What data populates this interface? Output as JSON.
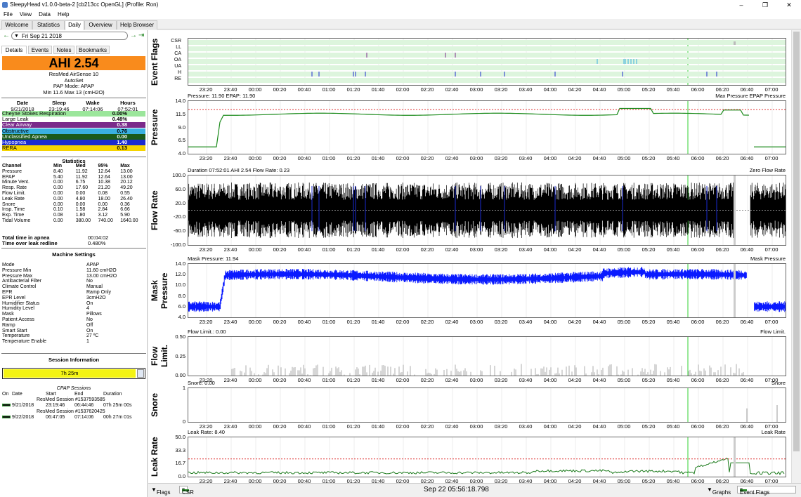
{
  "window": {
    "title": "SleepyHead v1.0.0-beta-2 [cb213cc OpenGL] (Profile: Ron)"
  },
  "menu": [
    "File",
    "View",
    "Data",
    "Help"
  ],
  "tabs": [
    "Welcome",
    "Statistics",
    "Daily",
    "Overview",
    "Help Browser"
  ],
  "date": {
    "value": "Fri Sep 21 2018"
  },
  "detail_tabs": [
    "Details",
    "Events",
    "Notes",
    "Bookmarks"
  ],
  "ahi": {
    "label": "AHI 2.54"
  },
  "machine": {
    "name": "ResMed AirSense 10",
    "model": "AutoSet",
    "mode": "PAP Mode: APAP",
    "range": "Min 11.6 Max 13 (cmH2O)"
  },
  "summary": {
    "headers": [
      "Date",
      "Sleep",
      "Wake",
      "Hours"
    ],
    "values": [
      "9/21/2018",
      "23:19:46",
      "07:14:06",
      "07:52:01"
    ]
  },
  "events": [
    {
      "name": "Cheyne Stokes Respiration",
      "value": "0.00%",
      "color": "#9be69b",
      "text": "#000"
    },
    {
      "name": "Large Leak",
      "value": "0.48%",
      "color": "#ffffff",
      "text": "#000"
    },
    {
      "name": "Clear Airway",
      "value": "0.38",
      "color": "#7a2a8a",
      "text": "#fff"
    },
    {
      "name": "Obstructive",
      "value": "0.76",
      "color": "#3ab0e0",
      "text": "#000"
    },
    {
      "name": "Unclassified Apnea",
      "value": "0.00",
      "color": "#1a5a1a",
      "text": "#fff"
    },
    {
      "name": "Hypopnea",
      "value": "1.40",
      "color": "#1a2ad0",
      "text": "#fff"
    },
    {
      "name": "RERA",
      "value": "0.13",
      "color": "#f5d400",
      "text": "#000"
    }
  ],
  "stats": {
    "title": "Statistics",
    "headers": [
      "Channel",
      "Min",
      "Med",
      "95%",
      "Max"
    ],
    "rows": [
      [
        "Pressure",
        "8.40",
        "11.92",
        "12.64",
        "13.00"
      ],
      [
        "EPAP",
        "5.40",
        "11.92",
        "12.64",
        "13.00"
      ],
      [
        "Minute Vent.",
        "0.00",
        "6.75",
        "10.38",
        "20.12"
      ],
      [
        "Resp. Rate",
        "0.00",
        "17.60",
        "21.20",
        "49.20"
      ],
      [
        "Flow Limit.",
        "0.00",
        "0.00",
        "0.08",
        "0.55"
      ],
      [
        "Leak Rate",
        "0.00",
        "4.80",
        "18.00",
        "26.40"
      ],
      [
        "Snore",
        "0.00",
        "0.00",
        "0.00",
        "0.36"
      ],
      [
        "Insp. Time",
        "0.10",
        "1.58",
        "2.84",
        "6.66"
      ],
      [
        "Exp. Time",
        "0.08",
        "1.80",
        "3.12",
        "5.90"
      ],
      [
        "Tidal Volume",
        "0.00",
        "380.00",
        "740.00",
        "1640.00"
      ]
    ],
    "apnea_time_label": "Total time in apnea",
    "apnea_time": "00:04:02",
    "leak_label": "Time over leak redline",
    "leak_value": "0.480%"
  },
  "settings": {
    "title": "Machine Settings",
    "rows": [
      [
        "Mode",
        "APAP"
      ],
      [
        "Pressure Min",
        "11.60 cmH2O"
      ],
      [
        "Pressure Max",
        "13.00 cmH2O"
      ],
      [
        "Antibacterial Filter",
        "No"
      ],
      [
        "Climate Control",
        "Manual"
      ],
      [
        "EPR",
        "Ramp Only"
      ],
      [
        "EPR Level",
        "3cmH2O"
      ],
      [
        "Humidifier Status",
        "On"
      ],
      [
        "Humidity Level",
        "4"
      ],
      [
        "Mask",
        "Pillows"
      ],
      [
        "Patient Access",
        "No"
      ],
      [
        "Ramp",
        "Off"
      ],
      [
        "Smart Start",
        "On"
      ],
      [
        "Temperature",
        "27 ºC"
      ],
      [
        "Temperature Enable",
        "1"
      ]
    ]
  },
  "session": {
    "title": "Session Information",
    "duration": "7h 25m",
    "cpap_title": "CPAP Sessions",
    "headers": [
      "On",
      "Date",
      "Start",
      "End",
      "Duration"
    ],
    "sessions": [
      {
        "name": "ResMed Session #1537593585",
        "date": "9/21/2018",
        "start": "23:19:46",
        "end": "06:44:46",
        "duration": "07h 25m 00s"
      },
      {
        "name": "ResMed Session #1537620425",
        "date": "9/22/2018",
        "start": "06:47:05",
        "end": "07:14:06",
        "duration": "00h 27m 01s"
      }
    ]
  },
  "xticks": [
    "23:20",
    "23:40",
    "00:00",
    "00:20",
    "00:40",
    "01:00",
    "01:20",
    "01:40",
    "02:00",
    "02:20",
    "02:40",
    "03:00",
    "03:20",
    "03:40",
    "04:00",
    "04:20",
    "04:40",
    "05:00",
    "05:20",
    "05:40",
    "06:00",
    "06:20",
    "06:40",
    "07:00"
  ],
  "graphs": {
    "flags": {
      "label": "Event Flags",
      "rows": [
        "CSR",
        "LL",
        "CA",
        "OA",
        "UA",
        "H",
        "RE"
      ]
    },
    "pressure": {
      "label": "Pressure",
      "title": "Pressure: 11.90 EPAP: 11.90",
      "legend": "Max Pressure EPAP Pressure",
      "yticks": [
        "14.0",
        "11.5",
        "9.0",
        "6.5",
        "4.0"
      ]
    },
    "flow": {
      "label": "Flow Rate",
      "title": "Duration 07:52:01 AHI 2.54 Flow Rate: 0.23",
      "legend": "Zero Flow Rate",
      "yticks": [
        "100.0",
        "60.0",
        "20.0",
        "-20.0",
        "-60.0",
        "-100.0"
      ]
    },
    "mask": {
      "label": "Mask Pressure",
      "title": "Mask Pressure: 11.94",
      "legend": "Mask Pressure",
      "yticks": [
        "14.0",
        "12.0",
        "10.0",
        "8.0",
        "6.0",
        "4.0"
      ]
    },
    "flowlim": {
      "label": "Flow Limit.",
      "title": "Flow Limit.: 0.00",
      "legend": "Flow Limit.",
      "yticks": [
        "0.50",
        "0.25",
        "0.00"
      ]
    },
    "snore": {
      "label": "Snore",
      "title": "Snore: 0.00",
      "legend": "Snore",
      "yticks": [
        "1",
        "0"
      ]
    },
    "leak": {
      "label": "Leak Rate",
      "title": "Leak Rate: 8.40",
      "legend": "Leak Rate",
      "yticks": [
        "50.0",
        "33.3",
        "16.7",
        "0.0"
      ]
    }
  },
  "bottom": {
    "flags": "Flags",
    "csr": "CSR",
    "time": "Sep 22 05:56:18.798",
    "graphs": "Graphs",
    "event_flags": "Event Flags"
  },
  "colors": {
    "ahi": "#f98b1c",
    "pressure": "#1a8a1a",
    "mask": "#0a1aff",
    "leak": "#1a7a1a",
    "cursor": "#30d030"
  }
}
